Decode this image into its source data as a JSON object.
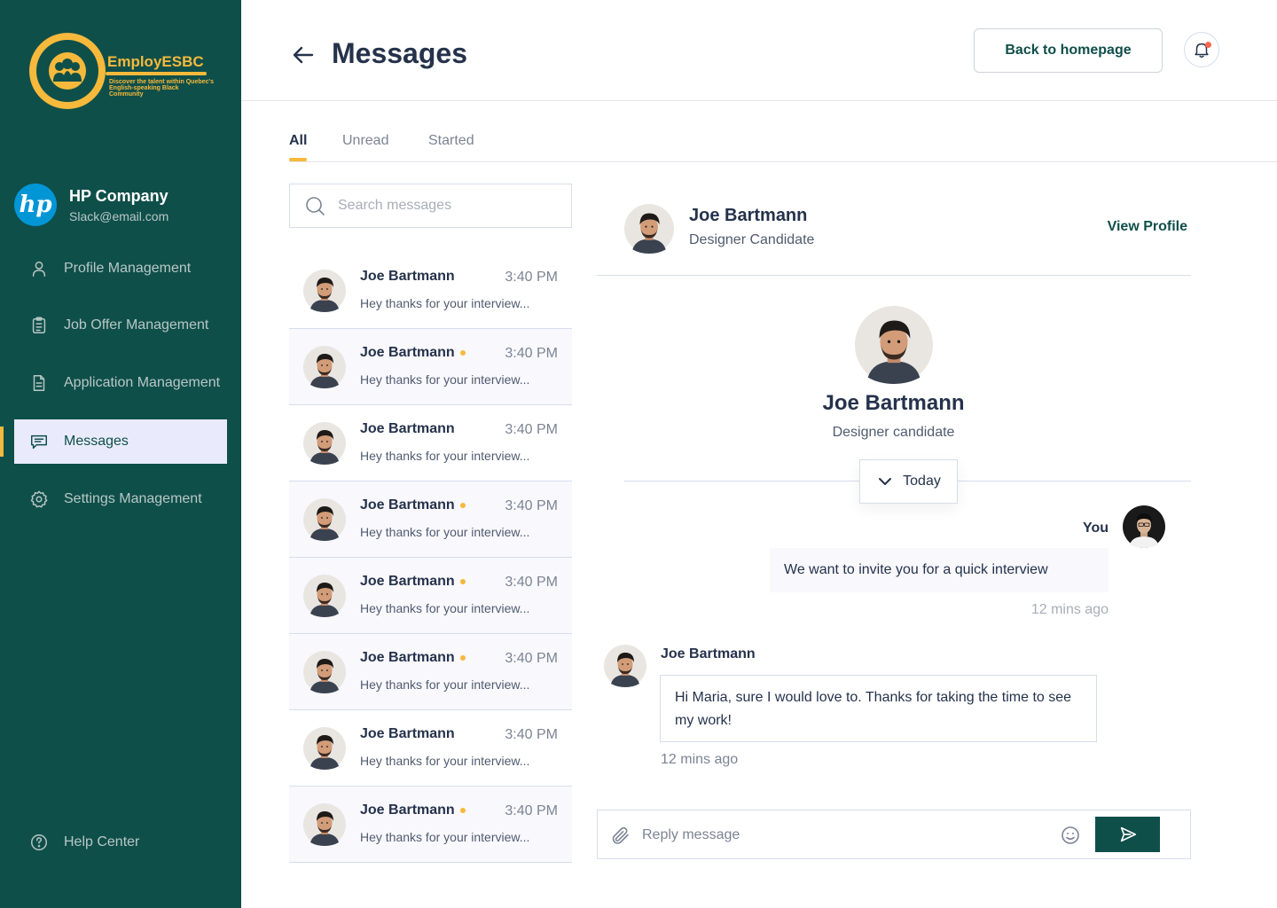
{
  "brand": {
    "name": "EmployESBC",
    "tagline": "Discover the talent within Quebec's English-speaking Black Community"
  },
  "company": {
    "logo_text": "hp",
    "name": "HP Company",
    "email": "Slack@email.com"
  },
  "nav": {
    "items": [
      {
        "label": "Profile Management",
        "icon": "user-icon"
      },
      {
        "label": "Job Offer Management",
        "icon": "clipboard-icon"
      },
      {
        "label": "Application Management",
        "icon": "document-icon"
      },
      {
        "label": "Messages",
        "icon": "chat-icon",
        "active": true
      },
      {
        "label": "Settings Management",
        "icon": "gear-icon"
      }
    ],
    "help": "Help Center"
  },
  "header": {
    "title": "Messages",
    "back_home": "Back to homepage"
  },
  "tabs": [
    "All",
    "Unread",
    "Started"
  ],
  "search": {
    "placeholder": "Search messages"
  },
  "conversations": [
    {
      "name": "Joe Bartmann",
      "time": "3:40 PM",
      "preview": "Hey thanks for your interview...",
      "unread": false
    },
    {
      "name": "Joe Bartmann",
      "time": "3:40 PM",
      "preview": "Hey thanks for your interview...",
      "unread": true
    },
    {
      "name": "Joe Bartmann",
      "time": "3:40 PM",
      "preview": "Hey thanks for your interview...",
      "unread": false
    },
    {
      "name": "Joe Bartmann",
      "time": "3:40 PM",
      "preview": "Hey thanks for your interview...",
      "unread": true
    },
    {
      "name": "Joe Bartmann",
      "time": "3:40 PM",
      "preview": "Hey thanks for your interview...",
      "unread": true
    },
    {
      "name": "Joe Bartmann",
      "time": "3:40 PM",
      "preview": "Hey thanks for your interview...",
      "unread": true
    },
    {
      "name": "Joe Bartmann",
      "time": "3:40 PM",
      "preview": "Hey thanks for your interview...",
      "unread": false
    },
    {
      "name": "Joe Bartmann",
      "time": "3:40 PM",
      "preview": "Hey thanks for your interview...",
      "unread": true
    }
  ],
  "chat": {
    "contact_name": "Joe Bartmann",
    "contact_role": "Designer Candidate",
    "view_profile": "View Profile",
    "profile_name": "Joe Bartmann",
    "profile_role": "Designer candidate",
    "day_label": "Today",
    "outgoing": {
      "sender": "You",
      "text": "We want to invite you for a quick interview",
      "time": "12 mins ago"
    },
    "incoming": {
      "sender": "Joe Bartmann",
      "text": "Hi Maria, sure I would love to. Thanks for taking the time to see my work!",
      "time": "12 mins ago"
    }
  },
  "reply": {
    "placeholder": "Reply message"
  },
  "colors": {
    "sidebar": "#0F4F4A",
    "accent": "#F6B93B",
    "active_nav_bg": "#E9EBFD",
    "unread_row_bg": "#F8F8FD",
    "notification_dot": "#FF6550"
  }
}
